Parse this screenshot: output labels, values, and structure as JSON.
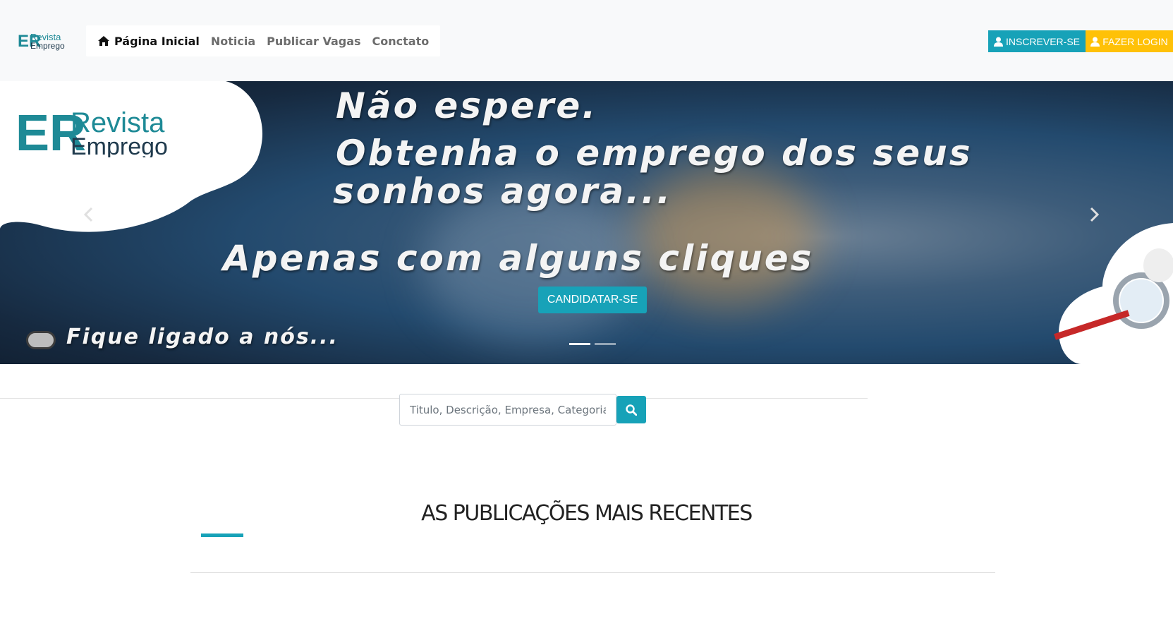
{
  "header": {
    "logo": {
      "line1": "Revista",
      "line2": "Emprego",
      "mark": "ER"
    },
    "nav": [
      {
        "label": "Página Inicial",
        "icon": "home-icon",
        "active": true
      },
      {
        "label": "Noticia"
      },
      {
        "label": "Publicar Vagas"
      },
      {
        "label": "Conctato"
      }
    ],
    "signup_label": "INSCREVER-SE",
    "login_label": "FAZER LOGIN"
  },
  "carousel": {
    "brand": {
      "line1": "Revista",
      "line2": "Emprego",
      "mark": "ER"
    },
    "lines": [
      "Não espere.",
      "Obtenha o emprego dos seus",
      "sonhos agora...",
      "Apenas com alguns cliques",
      "Fique ligado a nós..."
    ],
    "apply_label": "CANDIDATAR-SE",
    "slide_count": 2,
    "active_slide": 1
  },
  "search": {
    "placeholder": "Titulo, Descrição, Empresa, Categoria",
    "icon": "search-icon"
  },
  "section": {
    "title": "AS PUBLICAÇÕES MAIS RECENTES"
  },
  "colors": {
    "accent": "#17a2b8",
    "login": "#ffc107",
    "header_bg": "#f8f9fa",
    "brand_teal": "#1e8a96",
    "brand_dark": "#1f3a4d"
  }
}
